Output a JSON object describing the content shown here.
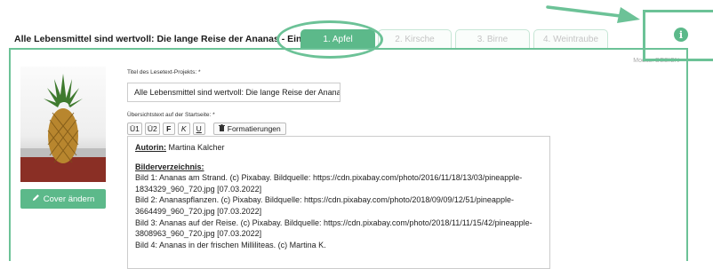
{
  "header": {
    "project_title": "Alle Lebensmittel sind wertvoll: Die lange Reise der Ananas - Eine Geschichte"
  },
  "tabs": [
    {
      "label": "1. Apfel"
    },
    {
      "label": "2. Kirsche"
    },
    {
      "label": "3. Birne"
    },
    {
      "label": "4. Weintraube"
    }
  ],
  "panel": {
    "mode_label": "Modus: DESIGN",
    "cover_button_label": "Cover ändern",
    "title_field_label": "Titel des Lesetext-Projekts: *",
    "title_field_value": "Alle Lebensmittel sind wertvoll: Die lange Reise der Ananas",
    "overview_label": "Übersichtstext auf der Startseite: *",
    "toolbar": {
      "h1": "Ü1",
      "h2": "Ü2",
      "bold": "F",
      "italic": "K",
      "underline": "U",
      "formatting": "Formatierungen"
    },
    "editor": {
      "author_label": "Autorin:",
      "author_name": " Martina Kalcher",
      "image_list_heading": "Bilderverzeichnis:",
      "lines": [
        "Bild 1: Ananas am Strand. (c) Pixabay. Bildquelle: https://cdn.pixabay.com/photo/2016/11/18/13/03/pineapple-",
        "1834329_960_720.jpg [07.03.2022]",
        "Bild 2: Ananaspflanzen. (c) Pixabay. Bildquelle: https://cdn.pixabay.com/photo/2018/09/09/12/51/pineapple-",
        "3664499_960_720.jpg [07.03.2022]",
        "Bild 3: Ananas auf der Reise. (c) Pixabay. Bildquelle: https://cdn.pixabay.com/photo/2018/11/11/15/42/pineapple-",
        "3808963_960_720.jpg [07.03.2022]",
        "Bild 4: Ananas in der frischen Milliliteas. (c) Martina K."
      ]
    }
  },
  "icons": {
    "cover": "pencil-icon",
    "formatting": "trash-icon",
    "info": "info-icon"
  },
  "colors": {
    "accent": "#5cb98a",
    "annotation": "#6cc297"
  }
}
